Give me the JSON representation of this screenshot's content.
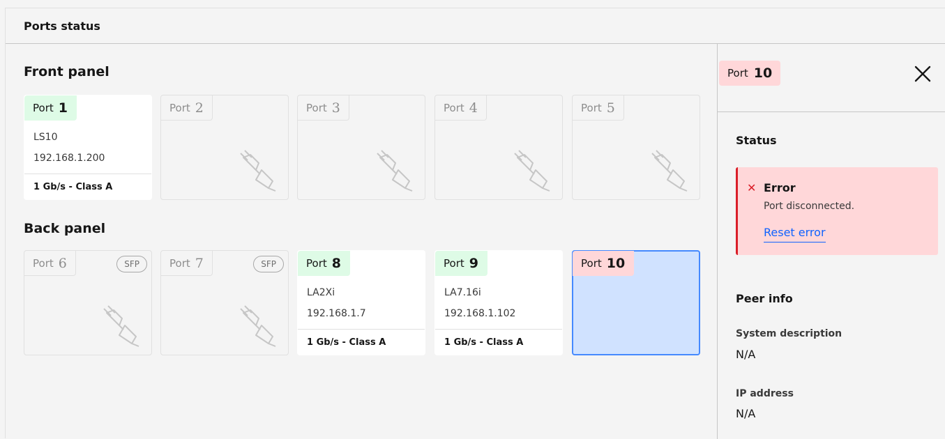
{
  "header": {
    "title": "Ports status"
  },
  "front_panel": {
    "title": "Front panel",
    "ports": [
      {
        "label": "Port",
        "number": "1",
        "connected": true,
        "device": "LS10",
        "ip": "192.168.1.200",
        "speed": "1 Gb/s - Class A"
      },
      {
        "label": "Port",
        "number": "2",
        "connected": false,
        "icon": "unplugged-icon"
      },
      {
        "label": "Port",
        "number": "3",
        "connected": false,
        "icon": "unplugged-icon"
      },
      {
        "label": "Port",
        "number": "4",
        "connected": false,
        "icon": "unplugged-icon"
      },
      {
        "label": "Port",
        "number": "5",
        "connected": false,
        "icon": "unplugged-icon"
      }
    ]
  },
  "back_panel": {
    "title": "Back panel",
    "ports": [
      {
        "label": "Port",
        "number": "6",
        "connected": false,
        "badge": "SFP",
        "icon": "unplugged-icon"
      },
      {
        "label": "Port",
        "number": "7",
        "connected": false,
        "badge": "SFP",
        "icon": "unplugged-icon"
      },
      {
        "label": "Port",
        "number": "8",
        "connected": true,
        "device": "LA2Xi",
        "ip": "192.168.1.7",
        "speed": "1 Gb/s - Class A"
      },
      {
        "label": "Port",
        "number": "9",
        "connected": true,
        "device": "LA7.16i",
        "ip": "192.168.1.102",
        "speed": "1 Gb/s - Class A"
      },
      {
        "label": "Port",
        "number": "10",
        "selected": true,
        "status": "error"
      }
    ]
  },
  "detail": {
    "port_label": "Port",
    "port_number": "10",
    "status_title": "Status",
    "error": {
      "title": "Error",
      "message": "Port disconnected.",
      "action": "Reset error"
    },
    "peer_title": "Peer info",
    "system_description_label": "System description",
    "system_description_value": "N/A",
    "ip_label": "IP address",
    "ip_value": "N/A"
  },
  "colors": {
    "connected_tag": "#defbe6",
    "error_tag": "#ffd7d9",
    "selected_bg": "#d0e2ff",
    "selected_border": "#4589ff",
    "error_accent": "#da1e28",
    "link": "#0f62fe"
  }
}
